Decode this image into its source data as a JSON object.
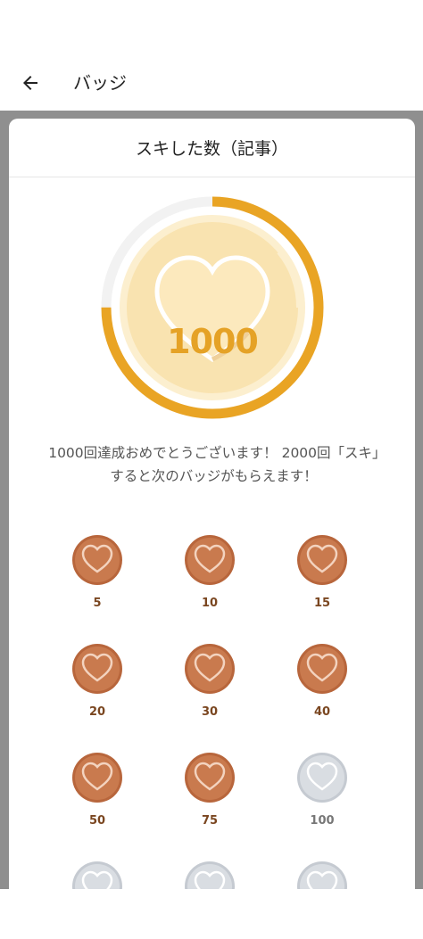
{
  "appbar": {
    "title": "バッジ",
    "back_icon": "arrow-left-icon"
  },
  "card": {
    "title": "スキした数（記事）",
    "hero": {
      "count": "1000",
      "progress": 0.75,
      "colors": {
        "ring": "#e9a424",
        "track": "#f2f2f2",
        "coin_fill": "#f9e3b0",
        "coin_edge": "#fcefcf",
        "heart_fill": "#fce9bd",
        "heart_edge": "#f5d79a"
      }
    },
    "message": "1000回達成おめでとうございます！ 2000回「スキ」すると次のバッジがもらえます！"
  },
  "badges": [
    {
      "label": "5",
      "state": "earned"
    },
    {
      "label": "10",
      "state": "earned"
    },
    {
      "label": "15",
      "state": "earned"
    },
    {
      "label": "20",
      "state": "earned"
    },
    {
      "label": "30",
      "state": "earned"
    },
    {
      "label": "40",
      "state": "earned"
    },
    {
      "label": "50",
      "state": "earned"
    },
    {
      "label": "75",
      "state": "earned"
    },
    {
      "label": "100",
      "state": "locked"
    },
    {
      "label": "",
      "state": "locked"
    },
    {
      "label": "",
      "state": "locked"
    },
    {
      "label": "",
      "state": "locked"
    }
  ],
  "badge_colors": {
    "earned_fill": "#c97a4e",
    "earned_edge": "#b8663c",
    "locked_fill": "#d9dde2",
    "locked_edge": "#c5cad1",
    "heart_stroke": "#f3d3bf"
  }
}
